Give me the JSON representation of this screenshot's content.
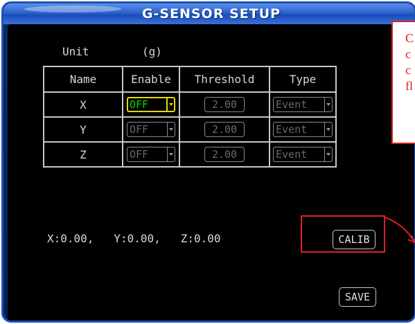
{
  "window": {
    "title": "G-SENSOR SETUP"
  },
  "unit": {
    "label": "Unit",
    "value": "(g)"
  },
  "table": {
    "headers": [
      "Name",
      "Enable",
      "Threshold",
      "Type"
    ],
    "rows": [
      {
        "name": "X",
        "enable": "OFF",
        "threshold": "2.00",
        "type": "Event",
        "focused": true
      },
      {
        "name": "Y",
        "enable": "OFF",
        "threshold": "2.00",
        "type": "Event",
        "focused": false
      },
      {
        "name": "Z",
        "enable": "OFF",
        "threshold": "2.00",
        "type": "Event",
        "focused": false
      }
    ]
  },
  "readout": {
    "x": "X:0.00,",
    "y": "Y:0.00,",
    "z": "Z:0.00"
  },
  "buttons": {
    "calib_label": "CALIB",
    "save_label": "SAVE"
  },
  "annotation": {
    "note_lines": [
      "C",
      "c",
      "c",
      "fl"
    ]
  },
  "colors": {
    "title_bar": "#2c62cf",
    "panel_background": "#000000",
    "focus_border": "#e8d800",
    "focus_text": "#00e000",
    "annotation_red": "#e02020"
  },
  "icons": {
    "combo_arrow": "chevron-down-icon"
  }
}
